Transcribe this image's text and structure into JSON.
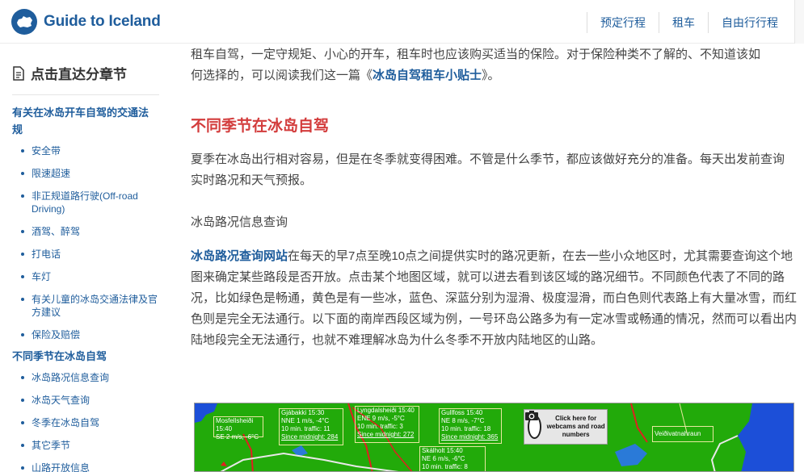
{
  "header": {
    "logo_text": "Guide to Iceland",
    "nav": [
      "预定行程",
      "租车",
      "自由行行程"
    ]
  },
  "sidebar": {
    "title": "点击直达分章节",
    "section1": "有关在冰岛开车自驾的交通法规",
    "section1_items": [
      "安全带",
      "限速超速",
      "非正规道路行驶(Off-road Driving)",
      "酒驾、醉驾",
      "打电话",
      "车灯",
      "有关儿童的冰岛交通法律及官方建议",
      "保险及赔偿"
    ],
    "section2": "不同季节在冰岛自驾",
    "section2_items": [
      "冰岛路况信息查询",
      "冰岛天气查询",
      "冬季在冰岛自驾",
      "其它季节",
      "山路开放信息"
    ]
  },
  "article": {
    "p1_line1": "租车自驾，一定守规矩、小心的开车，租车时也应该购买适当的保险。对于保险种类不了解的、不知道该如",
    "p1_line2_pre": "何选择的，可以阅读我们这一篇《",
    "p1_link": "冰岛自驾租车小贴士",
    "p1_line2_post": "》。",
    "heading": "不同季节在冰岛自驾",
    "p2": "夏季在冰岛出行相对容易，但是在冬季就变得困难。不管是什么季节，都应该做好充分的准备。每天出发前查询实时路况和天气预报。",
    "subheading": "冰岛路况信息查询",
    "p3_link": "冰岛路况查询网站",
    "p3": "在每天的早7点至晚10点之间提供实时的路况更新，在去一些小众地区时，尤其需要查询这个地图来确定某些路段是否开放。点击某个地图区域，就可以进去看到该区域的路况细节。不同颜色代表了不同的路况，比如绿色是畅通，黄色是有一些冰，蓝色、深蓝分别为湿滑、极度湿滑，而白色则代表路上有大量冰雪，而红色则是完全无法通行。以下面的南岸西段区域为例，一号环岛公路多为有一定冰雪或畅通的情况，然而可以看出内陆地段完全无法通行，也就不难理解冰岛为什么冬季不开放内陆地区的山路。"
  },
  "map": {
    "stations": [
      {
        "name": "Mosfellsheiði 15:40",
        "l2": "SE 2 m/s, -6°C"
      },
      {
        "name": "Gjábakki 15:30",
        "l2": "NNE 1 m/s, -4°C",
        "l3": "10 min. traffic: 11",
        "l4": "Since midnight: 284"
      },
      {
        "name": "Lyngdalsheiði 15:40",
        "l2": "ENE 9 m/s, -5°C",
        "l3": "10 min. traffic: 3",
        "l4": "Since midnight: 272"
      },
      {
        "name": "Gullfoss 15:40",
        "l2": "NE 8 m/s, -7°C",
        "l3": "10 min. traffic: 18",
        "l4": "Since midnight: 365"
      },
      {
        "name": "Skálholt 15:40",
        "l2": "NE 6 m/s, -6°C",
        "l3": "10 min. traffic: 8"
      }
    ],
    "webcam_text": "Click here for webcams and road numbers",
    "place": "Veiðivatnahraun"
  }
}
